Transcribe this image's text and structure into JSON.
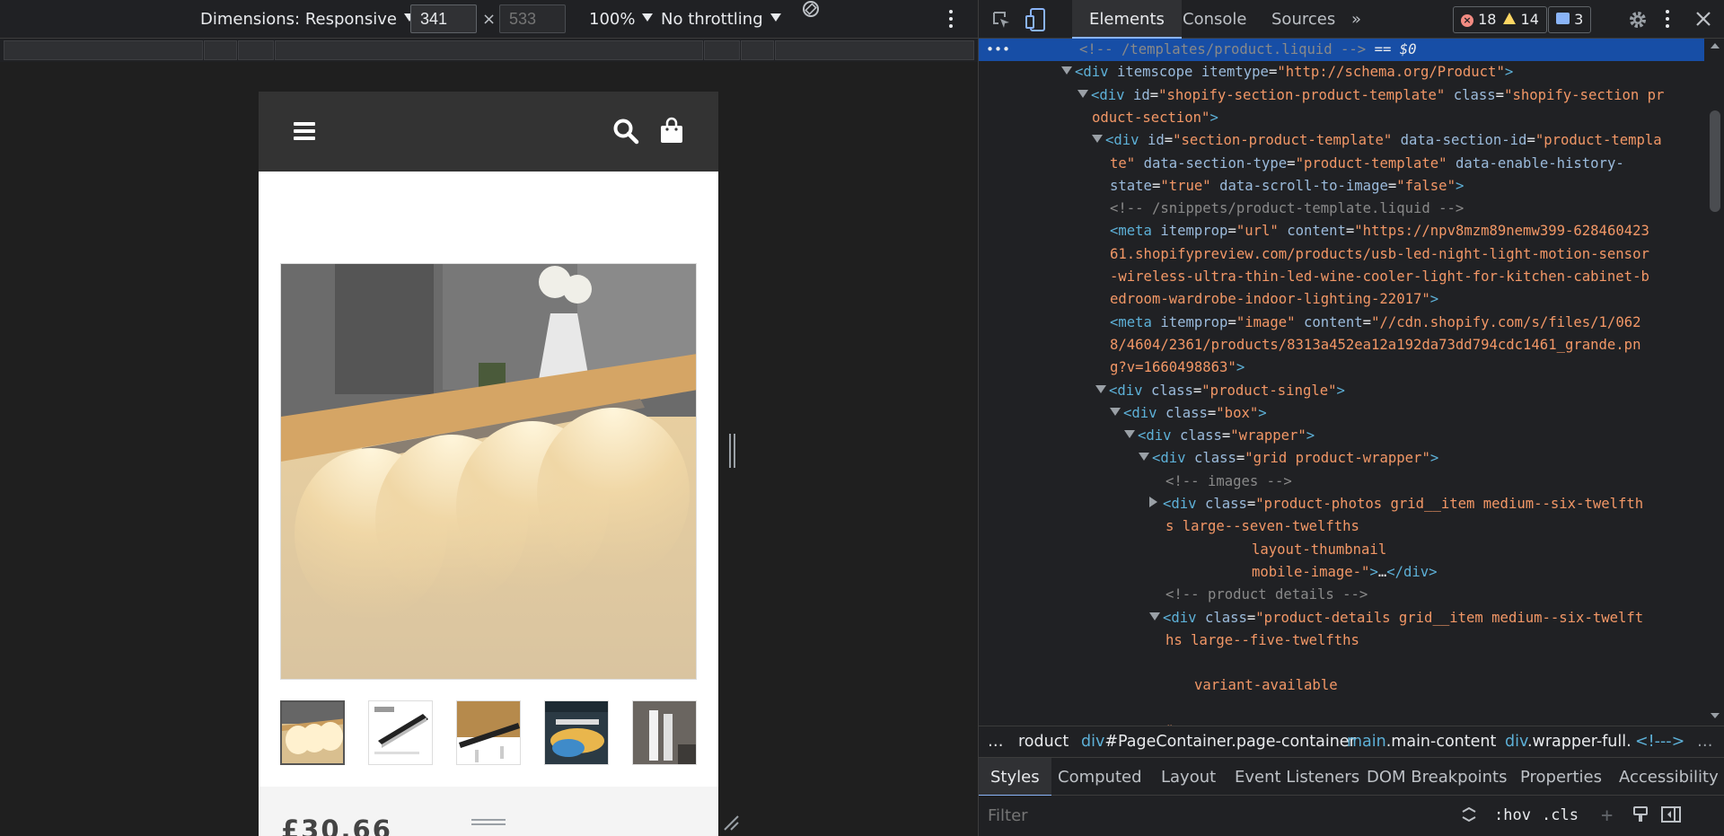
{
  "emulator": {
    "dimensions_label": "Dimensions: Responsive",
    "width_value": "341",
    "height_placeholder": "533",
    "times": "×",
    "zoom_label": "100%",
    "throttle_label": "No throttling"
  },
  "site": {
    "price": "£30.66"
  },
  "devtools": {
    "tabs": [
      "Elements",
      "Console",
      "Sources",
      "»"
    ],
    "issues": {
      "errors": "18",
      "warnings": "14",
      "messages": "3"
    },
    "dom_lines": [
      {
        "cls": "sel",
        "html": "<span class='cm'>&lt;!-- /templates/product.liquid --&gt;</span> <span class='sv'>== $0</span>"
      },
      {
        "html": "<span class='tri'></span><span class='tag'>&lt;div</span> <span class='an'>itemscope</span> <span class='an'>itemtype</span>=<span class='av'>\"http://schema.org/Product\"</span><span class='tag'>&gt;</span>"
      },
      {
        "html": "<span class='tri'></span><span class='tag'>&lt;div</span> <span class='an'>id</span>=<span class='av'>\"shopify-section-product-template\"</span> <span class='an'>class</span>=<span class='av'>\"shopify-section pr</span>"
      },
      {
        "html": "<span class='av'>oduct-section\"</span><span class='tag'>&gt;</span>"
      },
      {
        "html": "<span class='tri'></span><span class='tag'>&lt;div</span> <span class='an'>id</span>=<span class='av'>\"section-product-template\"</span> <span class='an'>data-section-id</span>=<span class='av'>\"product-templa</span>"
      },
      {
        "html": "<span class='av'>te\"</span> <span class='an'>data-section-type</span>=<span class='av'>\"product-template\"</span> <span class='an'>data-enable-history-</span>"
      },
      {
        "html": "<span class='an'>state</span>=<span class='av'>\"true\"</span> <span class='an'>data-scroll-to-image</span>=<span class='av'>\"false\"</span><span class='tag'>&gt;</span>"
      },
      {
        "html": "<span class='cm'>&lt;!-- /snippets/product-template.liquid --&gt;</span>"
      },
      {
        "html": "<span class='tag'>&lt;meta</span> <span class='an'>itemprop</span>=<span class='av'>\"url\"</span> <span class='an'>content</span>=<span class='av'>\"https://npv8mzm89nemw399-628460423</span>"
      },
      {
        "html": "<span class='av'>61.shopifypreview.com/products/usb-led-night-light-motion-sensor</span>"
      },
      {
        "html": "<span class='av'>-wireless-ultra-thin-led-wine-cooler-light-for-kitchen-cabinet-b</span>"
      },
      {
        "html": "<span class='av'>edroom-wardrobe-indoor-lighting-22017\"</span><span class='tag'>&gt;</span>"
      },
      {
        "html": "<span class='tag'>&lt;meta</span> <span class='an'>itemprop</span>=<span class='av'>\"image\"</span> <span class='an'>content</span>=<span class='av'>\"//cdn.shopify.com/s/files/1/062</span>"
      },
      {
        "html": "<span class='av'>8/4604/2361/products/8313a452ea12a192da73dd794cdc1461_grande.pn</span>"
      },
      {
        "html": "<span class='av'>g?v=1660498863\"</span><span class='tag'>&gt;</span>"
      },
      {
        "html": "<span class='tri'></span><span class='tag'>&lt;div</span> <span class='an'>class</span>=<span class='av'>\"product-single\"</span><span class='tag'>&gt;</span>"
      },
      {
        "html": "<span class='tri'></span><span class='tag'>&lt;div</span> <span class='an'>class</span>=<span class='av'>\"box\"</span><span class='tag'>&gt;</span>"
      },
      {
        "html": "<span class='tri'></span><span class='tag'>&lt;div</span> <span class='an'>class</span>=<span class='av'>\"wrapper\"</span><span class='tag'>&gt;</span>"
      },
      {
        "html": "<span class='tri'></span><span class='tag'>&lt;div</span> <span class='an'>class</span>=<span class='av'>\"grid product-wrapper\"</span><span class='tag'>&gt;</span>"
      },
      {
        "html": "<span class='cm'>&lt;!-- images --&gt;</span>"
      },
      {
        "html": "<span class='tri c'></span><span class='tag'>&lt;div</span> <span class='an'>class</span>=<span class='av'>\"product-photos grid__item medium--six-twelfth</span>"
      },
      {
        "html": "<span class='av'>s large--seven-twelfths</span>"
      },
      {
        "html": "<span class='av'>layout-thumbnail</span>"
      },
      {
        "html": "<span class='av'>mobile-image-\"</span><span class='tag'>&gt;</span>…<span class='tag'>&lt;/div&gt;</span>"
      },
      {
        "html": "<span class='cm'>&lt;!-- product details --&gt;</span>"
      },
      {
        "html": "<span class='tri'></span><span class='tag'>&lt;div</span> <span class='an'>class</span>=<span class='av'>\"product-details grid__item medium--six-twelft</span>"
      },
      {
        "html": "<span class='av'>hs large--five-twelfths</span>"
      },
      {
        "html": ""
      },
      {
        "html": "<span class='av'>variant-available</span>"
      },
      {
        "html": ""
      },
      {
        "html": "<span class='av'>\"</span>"
      }
    ],
    "breadcrumbs": [
      {
        "tag": "",
        "id": "roduct"
      },
      {
        "tag": "div",
        "id": "#PageContainer.page-container"
      },
      {
        "tag": "main",
        "id": ".main-content"
      },
      {
        "tag": "div",
        "id": ".wrapper-full."
      },
      {
        "tag": "<!--->",
        "id": ""
      }
    ],
    "styles_tabs": [
      "Styles",
      "Computed",
      "Layout",
      "Event Listeners",
      "DOM Breakpoints",
      "Properties",
      "Accessibility"
    ],
    "filter_placeholder": "Filter",
    "hov_label": ":hov",
    "cls_label": ".cls",
    "plus_label": "+"
  }
}
